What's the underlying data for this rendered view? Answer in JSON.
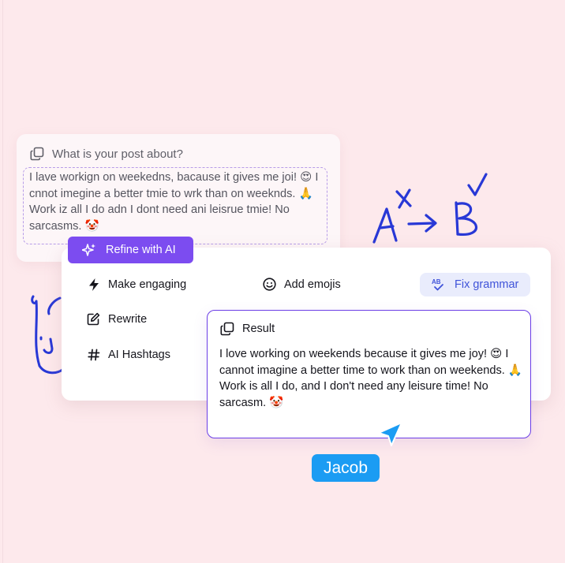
{
  "input_card": {
    "label": "What is your post about?",
    "text": "I lave workign on weekedns, bacause it gives me joi! 😍 I cnnot imegine a better tmie to wrk than on weeknds. 🙏 Work iz all I do adn I dont need ani leisrue tmie! No sarcasms. 🤡"
  },
  "tools": {
    "refine_label": "Refine with AI",
    "make_engaging": "Make engaging",
    "add_emojis": "Add emojis",
    "fix_grammar": "Fix grammar",
    "rewrite": "Rewrite",
    "ai_hashtags": "AI Hashtags"
  },
  "result": {
    "label": "Result",
    "text": "I love working on weekends because it gives me joy! 😍 I cannot imagine a better time to work than on weekends. 🙏 Work is all I do, and I don't need any leisure time! No sarcasm. 🤡"
  },
  "cursor": {
    "name": "Jacob"
  },
  "colors": {
    "background": "#fde9ec",
    "accent": "#7c4cf0",
    "fix_grammar_text": "#3f53d9",
    "cursor": "#1b9cf3",
    "doodle": "#2838d6"
  }
}
